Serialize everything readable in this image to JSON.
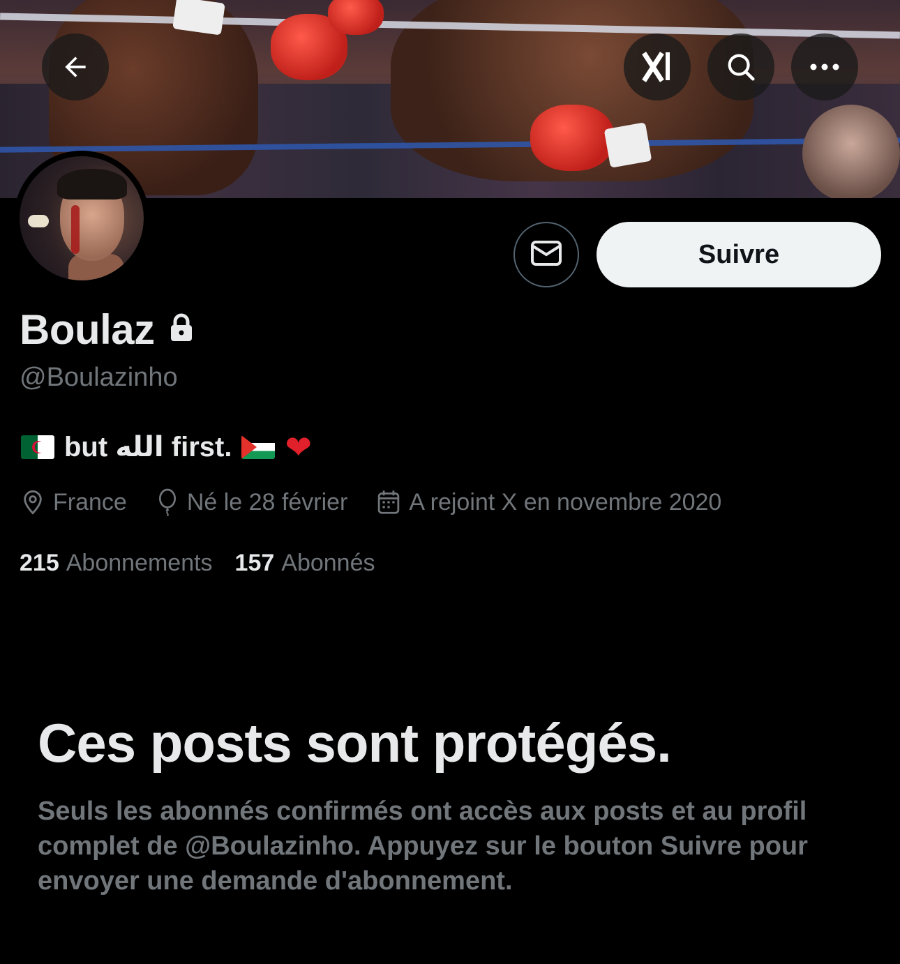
{
  "header": {
    "back_icon": "arrow-left-icon",
    "grok_icon": "grok-icon",
    "search_icon": "search-icon",
    "more_icon": "more-horizontal-icon"
  },
  "actions": {
    "message_icon": "envelope-icon",
    "follow_label": "Suivre"
  },
  "profile": {
    "display_name": "Boulaz",
    "protected_icon": "lock-icon",
    "handle": "@Boulazinho",
    "bio": {
      "text": "but الله first."
    },
    "location": "France",
    "birthday": "Né le 28 février",
    "joined": "A rejoint X en novembre 2020"
  },
  "stats": {
    "following_count": "215",
    "following_label": "Abonnements",
    "followers_count": "157",
    "followers_label": "Abonnés"
  },
  "protected": {
    "title": "Ces posts sont protégés.",
    "description": "Seuls les abonnés confirmés ont accès aux posts et au profil complet de @Boulazinho. Appuyez sur le bouton Suivre pour envoyer une demande d'abonnement."
  },
  "colors": {
    "background": "#000000",
    "primary_text": "#e7e9ea",
    "secondary_text": "#71767b",
    "follow_button_bg": "#eff3f4"
  }
}
